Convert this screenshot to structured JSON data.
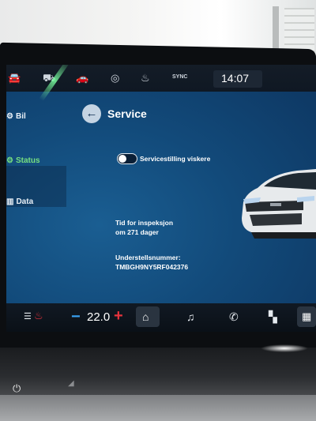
{
  "status_bar": {
    "icons": [
      "car-front-icon",
      "driver-assist-icon",
      "car-side-icon",
      "speed-limit-icon",
      "seat-heat-icon"
    ],
    "sync_label": "SYNC",
    "time": "14:07"
  },
  "sidebar": {
    "items": [
      {
        "label": "Bil",
        "icon": "car-icon"
      },
      {
        "label": "Status",
        "icon": "car-status-icon"
      },
      {
        "label": "Data",
        "icon": "chart-icon"
      }
    ],
    "active_index": 1,
    "active_color": "#77e07f"
  },
  "header": {
    "title": "Service",
    "back_icon": "back-arrow-icon"
  },
  "settings": {
    "wiper_service_mode_label": "Servicestilling viskere",
    "wiper_service_mode_on": false
  },
  "inspection": {
    "line1": "Tid for inspeksjon",
    "line2": "om 271 dager"
  },
  "vin": {
    "label": "Understellsnummer:",
    "value": "TMBGH9NY5RF042376"
  },
  "bottom_bar": {
    "temperature": "22.0",
    "minus_glyph": "−",
    "plus_glyph": "+",
    "icons": [
      "seat-heat-icon",
      "home-icon",
      "music-icon",
      "phone-icon",
      "apps-icon",
      "grid-icon"
    ],
    "minus_color": "#3aa2f3",
    "plus_color": "#e8333d"
  }
}
